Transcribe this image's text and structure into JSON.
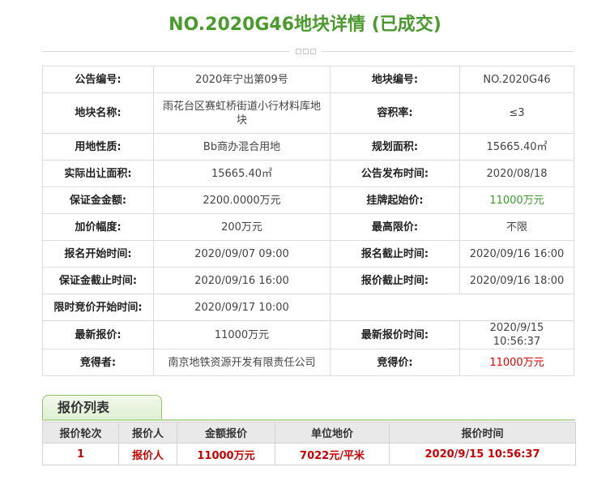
{
  "page": {
    "title": "NO.2020G46地块详情 (已成交)"
  },
  "details": {
    "rows": [
      [
        {
          "label": "公告编号:",
          "value": "2020年宁出第09号"
        },
        {
          "label": "地块编号:",
          "value": "NO.2020G46"
        }
      ],
      [
        {
          "label": "地块名称:",
          "value": "雨花台区赛虹桥街道小行材料库地块"
        },
        {
          "label": "容积率:",
          "value": "≤3"
        }
      ],
      [
        {
          "label": "用地性质:",
          "value": "Bb商办混合用地"
        },
        {
          "label": "规划面积:",
          "value": "15665.40㎡"
        }
      ],
      [
        {
          "label": "实际出让面积:",
          "value": "15665.40㎡"
        },
        {
          "label": "公告发布时间:",
          "value": "2020/08/18"
        }
      ],
      [
        {
          "label": "保证金金额:",
          "value": "2200.0000万元"
        },
        {
          "label": "挂牌起始价:",
          "value": "11000万元"
        }
      ],
      [
        {
          "label": "加价幅度:",
          "value": "200万元"
        },
        {
          "label": "最高限价:",
          "value": "不限"
        }
      ],
      [
        {
          "label": "报名开始时间:",
          "value": "2020/09/07 09:00"
        },
        {
          "label": "报名截止时间:",
          "value": "2020/09/16 16:00"
        }
      ],
      [
        {
          "label": "保证金截止时间:",
          "value": "2020/09/16 16:00"
        },
        {
          "label": "报价截止时间:",
          "value": "2020/09/16 18:00"
        }
      ],
      [
        {
          "label": "限时竞价开始时间:",
          "value": "2020/09/17 10:00"
        },
        {
          "label": "",
          "value": ""
        }
      ],
      [
        {
          "label": "最新报价:",
          "value": "11000万元"
        },
        {
          "label": "最新报价时间:",
          "value": "2020/9/15 10:56:37"
        }
      ],
      [
        {
          "label": "竞得者:",
          "value": "南京地铁资源开发有限责任公司"
        },
        {
          "label": "竞得价:",
          "value": "11000万元"
        }
      ]
    ]
  },
  "bid_list": {
    "tab_label": "报价列表",
    "headers": [
      "报价轮次",
      "报价人",
      "金额报价",
      "单位地价",
      "报价时间"
    ],
    "rows": [
      [
        "1",
        "报价人",
        "11000万元",
        "7022元/平米",
        "2020/9/15 10:56:37"
      ]
    ]
  },
  "colors": {
    "title_green": "#4a9a2e",
    "price_green": "#3c9a2a",
    "price_red": "#e60000",
    "bid_red": "#cc0000"
  }
}
